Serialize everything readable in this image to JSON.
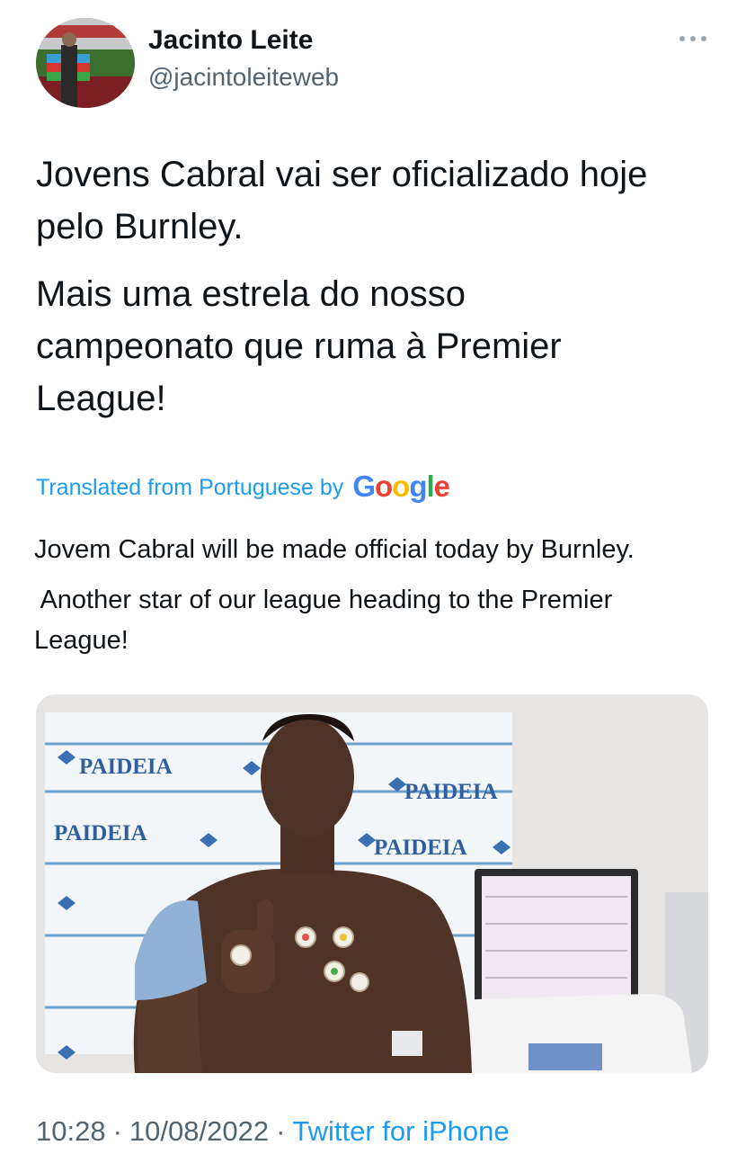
{
  "author": {
    "name": "Jacinto Leite",
    "handle": "@jacintoleiteweb"
  },
  "tweet": {
    "lines": [
      "Jovens Cabral vai ser oficializado hoje",
      "pelo Burnley.",
      "Mais uma estrela do nosso",
      "campeonato que ruma à Premier",
      "League!"
    ]
  },
  "translation": {
    "label": "Translated from Portuguese by",
    "provider": [
      "G",
      "o",
      "o",
      "g",
      "l",
      "e"
    ],
    "lines": [
      "Jovem Cabral will be made official today by Burnley.",
      " Another star of our league heading to the Premier",
      "League!"
    ]
  },
  "media": {
    "sponsor_text": "PAIDEIA"
  },
  "meta": {
    "time": "10:28",
    "date": "10/08/2022",
    "separator": "·",
    "source": "Twitter for iPhone"
  },
  "icons": {
    "more": "more-horizontal-icon",
    "google": "google-logo"
  },
  "colors": {
    "link": "#1d9bf0",
    "secondary_text": "#536471",
    "primary_text": "#0f1419",
    "google": [
      "#4285f4",
      "#ea4335",
      "#fbbc05",
      "#4285f4",
      "#34a853",
      "#ea4335"
    ]
  }
}
